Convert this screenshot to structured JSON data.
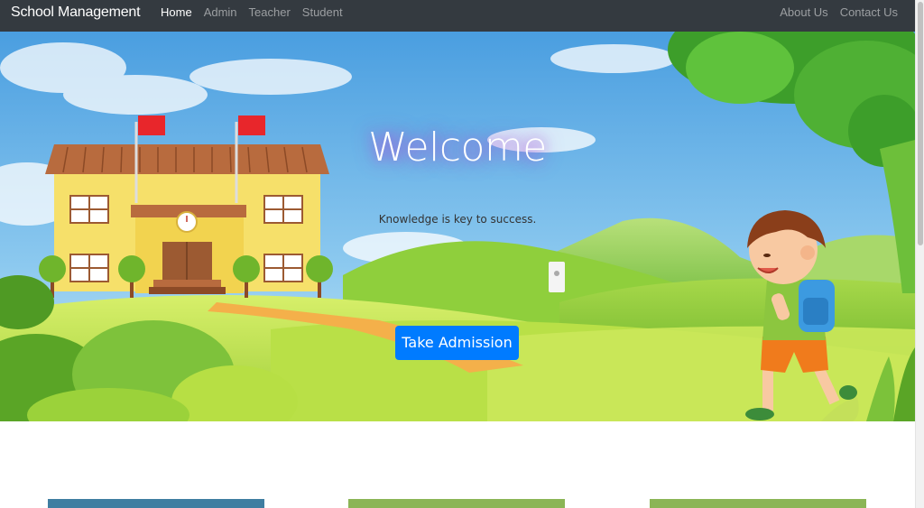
{
  "navbar": {
    "brand": "School Management",
    "left_links": [
      {
        "label": "Home",
        "active": true
      },
      {
        "label": "Admin",
        "active": false
      },
      {
        "label": "Teacher",
        "active": false
      },
      {
        "label": "Student",
        "active": false
      }
    ],
    "right_links": [
      {
        "label": "About Us"
      },
      {
        "label": "Contact Us"
      }
    ]
  },
  "hero": {
    "title": "Welcome",
    "tagline": "Knowledge is key to success.",
    "cta_label": "Take Admission",
    "illustration": "school-building-and-boy-illustration"
  },
  "colors": {
    "navbar_bg": "#343a40",
    "primary": "#007bff",
    "card_blue": "#3f7ea1",
    "card_green": "#8bb556"
  }
}
